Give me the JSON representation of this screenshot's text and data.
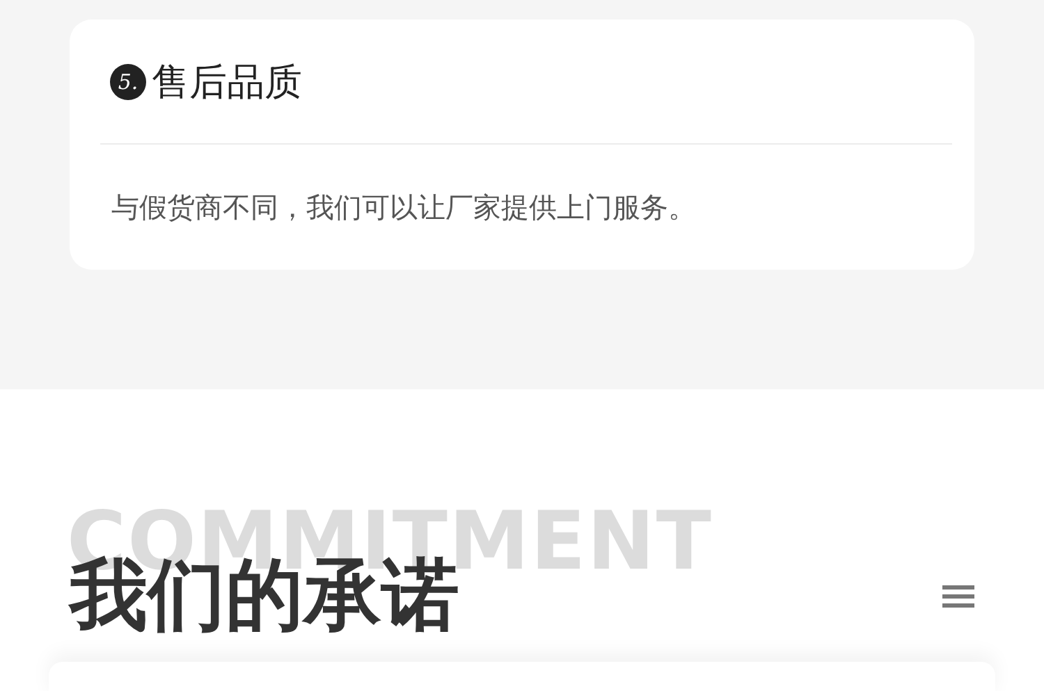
{
  "card": {
    "number": "5.",
    "title": "售后品质",
    "text": "与假货商不同，我们可以让厂家提供上门服务。"
  },
  "section": {
    "background_word": "COMMITMENT",
    "title": "我们的承诺"
  }
}
